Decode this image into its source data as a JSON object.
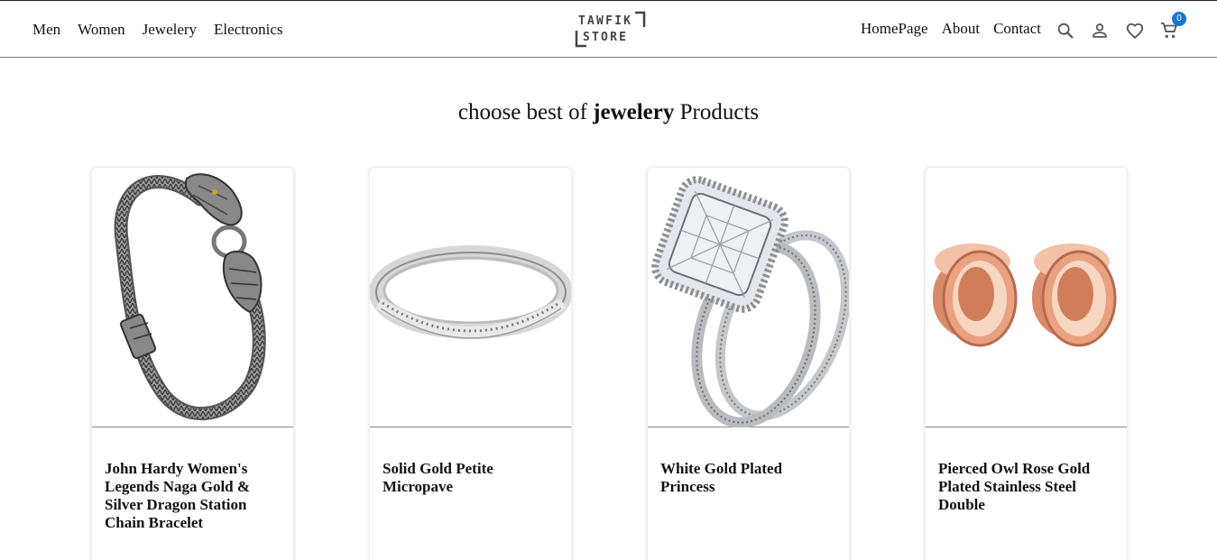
{
  "header": {
    "nav_left": [
      "Men",
      "Women",
      "Jewelery",
      "Electronics"
    ],
    "logo": {
      "line1": "TAWFIK",
      "line2": "STORE"
    },
    "nav_right": [
      "HomePage",
      "About",
      "Contact"
    ],
    "icons": [
      "search-icon",
      "account-icon",
      "heart-icon",
      "cart-icon"
    ],
    "cart_count": "0",
    "badge_color": "#1976d2"
  },
  "main": {
    "heading_prefix": "choose best of ",
    "heading_category": "jewelery",
    "heading_suffix": " Products",
    "products": [
      {
        "title": "John Hardy Women's Legends Naga Gold & Silver Dragon Station Chain Bracelet",
        "image": "silver dragon chain bracelet"
      },
      {
        "title": "Solid Gold Petite Micropave",
        "image": "silver micropave ring"
      },
      {
        "title": "White Gold Plated Princess",
        "image": "diamond princess ring set"
      },
      {
        "title": "Pierced Owl Rose Gold Plated Stainless Steel Double",
        "image": "rose gold ear plugs"
      }
    ]
  }
}
